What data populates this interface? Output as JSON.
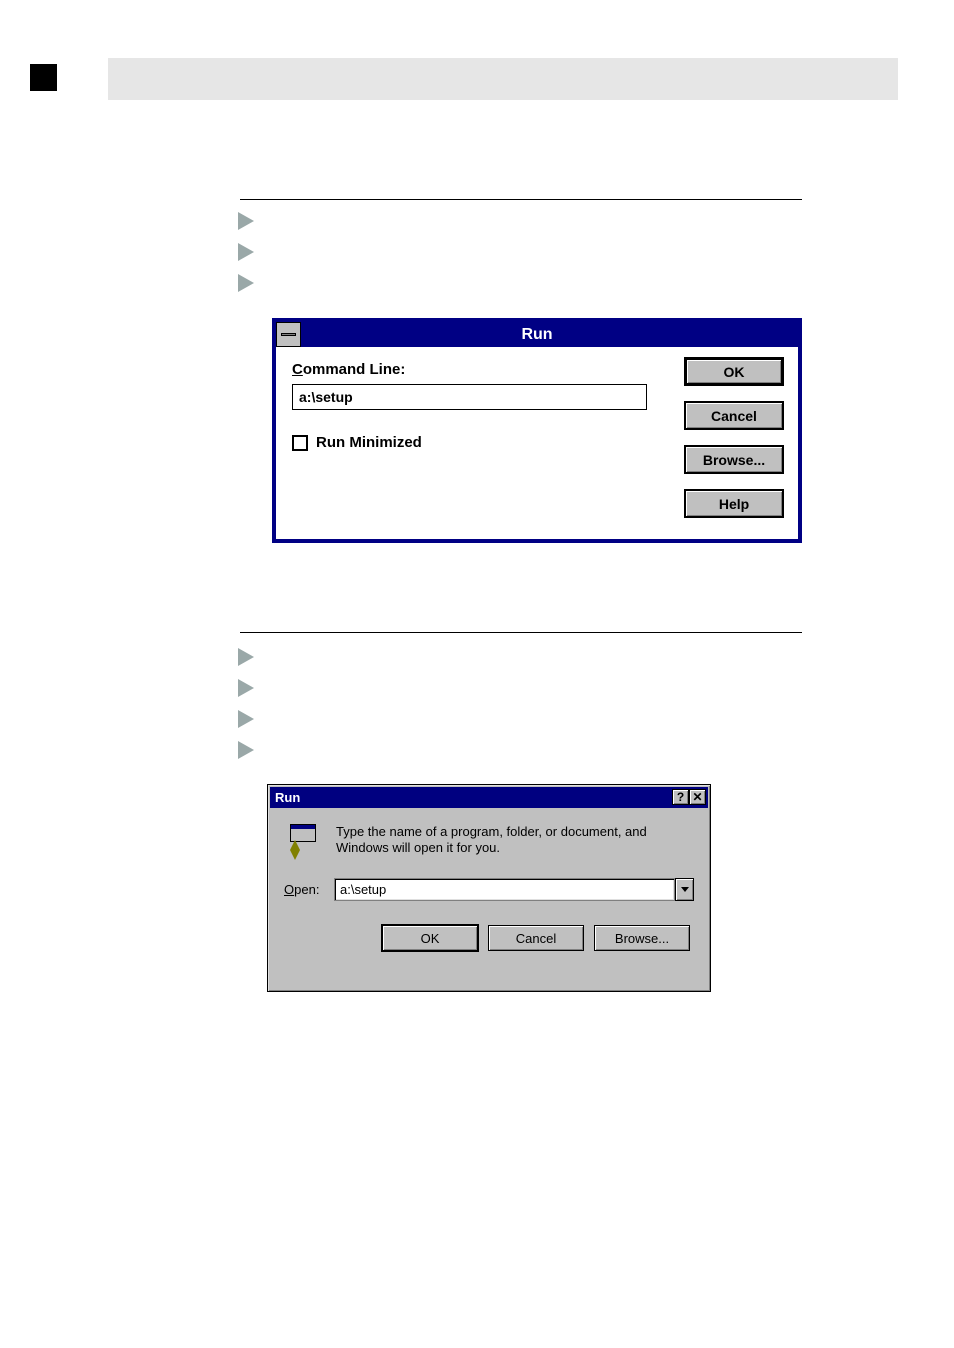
{
  "win31": {
    "title": "Run",
    "command_label_pre": "C",
    "command_label_rest": "ommand Line:",
    "command_value": "a:\\setup",
    "minimized_pre": "Run ",
    "minimized_u": "M",
    "minimized_rest": "inimized",
    "buttons": {
      "ok": "OK",
      "cancel": "Cancel",
      "browse_u": "B",
      "browse_rest": "rowse...",
      "help_u": "H",
      "help_rest": "elp"
    }
  },
  "win95": {
    "title": "Run",
    "description": "Type the name of a program, folder, or document, and Windows will open it for you.",
    "open_u": "O",
    "open_rest": "pen:",
    "open_value": "a:\\setup",
    "buttons": {
      "ok": "OK",
      "cancel": "Cancel",
      "browse_u": "B",
      "browse_rest": "rowse..."
    }
  }
}
